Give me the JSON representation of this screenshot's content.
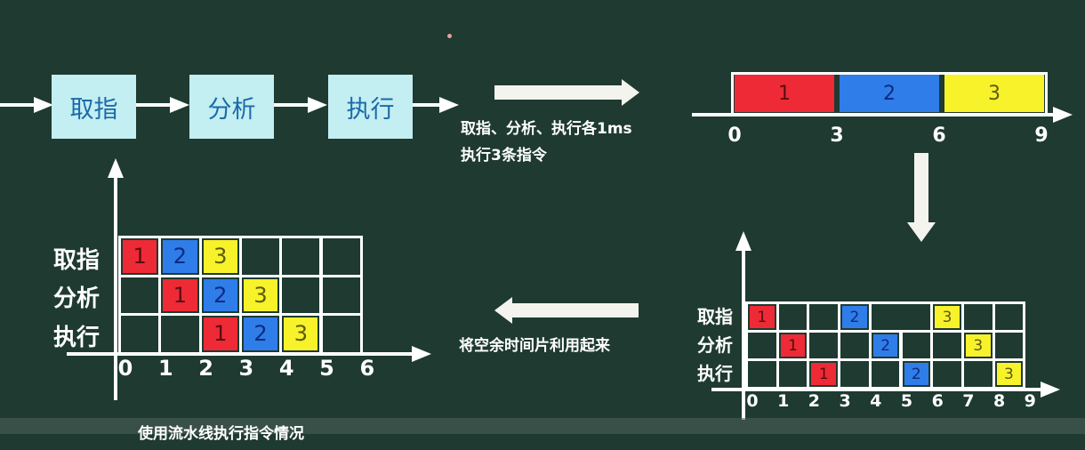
{
  "stages": [
    "取指",
    "分析",
    "执行"
  ],
  "colors": {
    "1": "#ee2a36",
    "2": "#2f7de8",
    "3": "#f7f22a",
    "numtext": {
      "1": "#5a0c10",
      "2": "#0d2a80",
      "3": "#5a5a10"
    }
  },
  "note": {
    "line1": "取指、分析、执行各1ms",
    "line2": "执行3条指令"
  },
  "sequential_bar": {
    "segments": [
      "1",
      "2",
      "3"
    ],
    "ticks": [
      "0",
      "3",
      "6",
      "9"
    ]
  },
  "sequential_grid": {
    "row_labels": [
      "取指",
      "分析",
      "执行"
    ],
    "rows": [
      [
        "1",
        "",
        "",
        "2",
        "",
        "3",
        "",
        ""
      ],
      [
        "",
        "1",
        "",
        "",
        "2",
        "",
        "",
        "3",
        ""
      ],
      [
        "",
        "",
        "1",
        "",
        "",
        "2",
        "",
        "",
        "3"
      ]
    ],
    "ticks": [
      "0",
      "1",
      "2",
      "3",
      "4",
      "5",
      "6",
      "7",
      "8",
      "9"
    ]
  },
  "reuse_label": "将空余时间片利用起来",
  "pipeline_grid": {
    "row_labels": [
      "取指",
      "分析",
      "执行"
    ],
    "rows": [
      [
        "1",
        "2",
        "3",
        "",
        "",
        ""
      ],
      [
        "",
        "1",
        "2",
        "3",
        "",
        ""
      ],
      [
        "",
        "",
        "1",
        "2",
        "3",
        ""
      ]
    ],
    "ticks": [
      "0",
      "1",
      "2",
      "3",
      "4",
      "5",
      "6"
    ]
  },
  "caption": "使用流水线执行指令情况"
}
